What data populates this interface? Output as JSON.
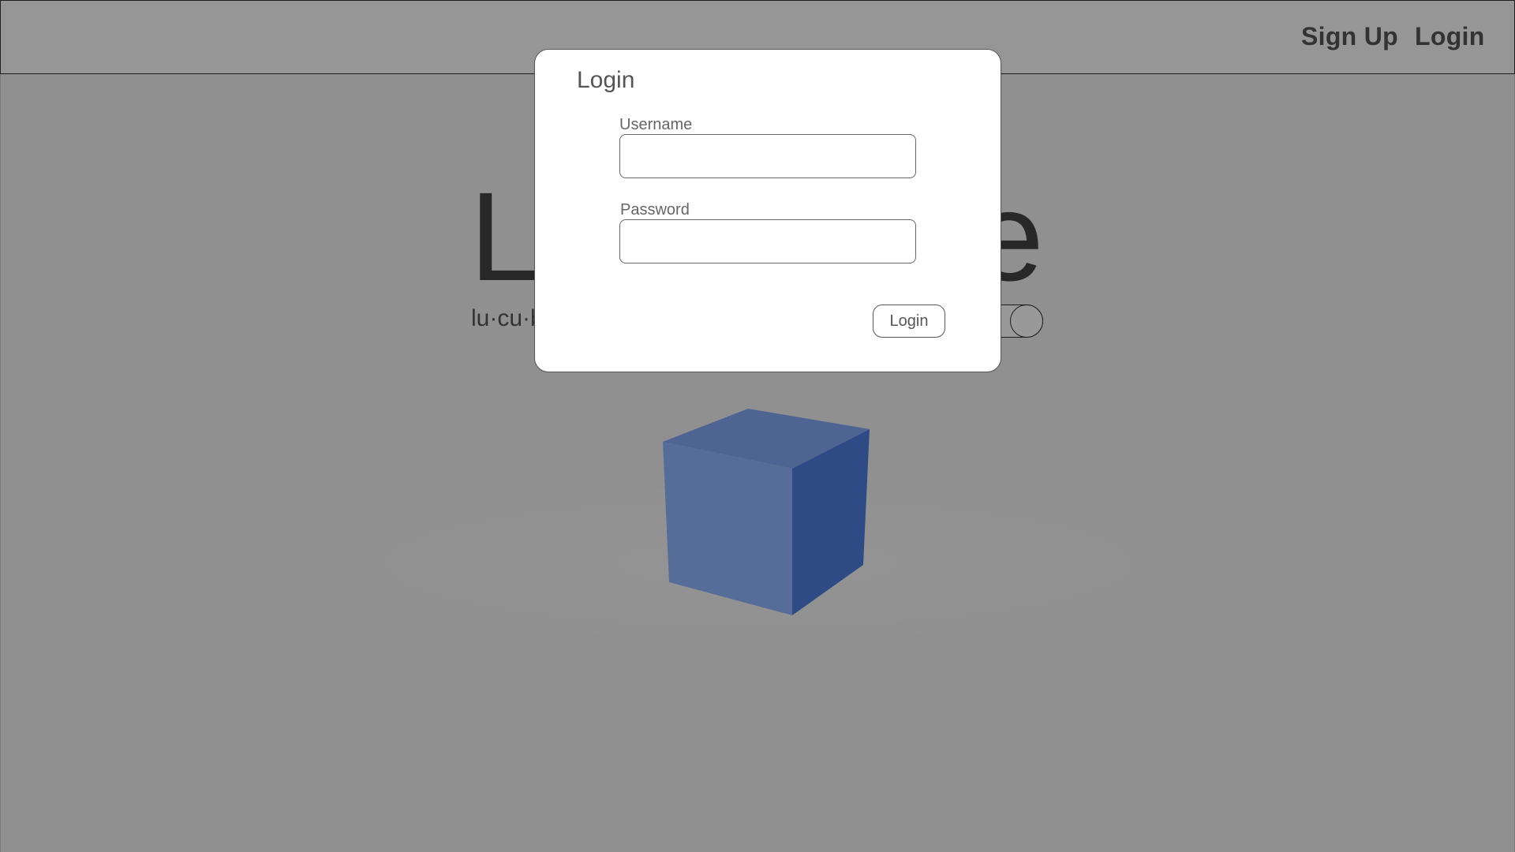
{
  "nav": {
    "signup_label": "Sign Up",
    "login_label": "Login"
  },
  "hero": {
    "title": "Lucubrate",
    "pronunciation": "lu·cu·brate"
  },
  "login_modal": {
    "title": "Login",
    "username_label": "Username",
    "username_value": "",
    "password_label": "Password",
    "password_value": "",
    "submit_label": "Login"
  },
  "colors": {
    "cube_front": "#8fb4ff",
    "cube_top": "#83a9f5",
    "cube_side": "#4d7ee0",
    "overlay": "rgba(0,0,0,0.40)"
  }
}
